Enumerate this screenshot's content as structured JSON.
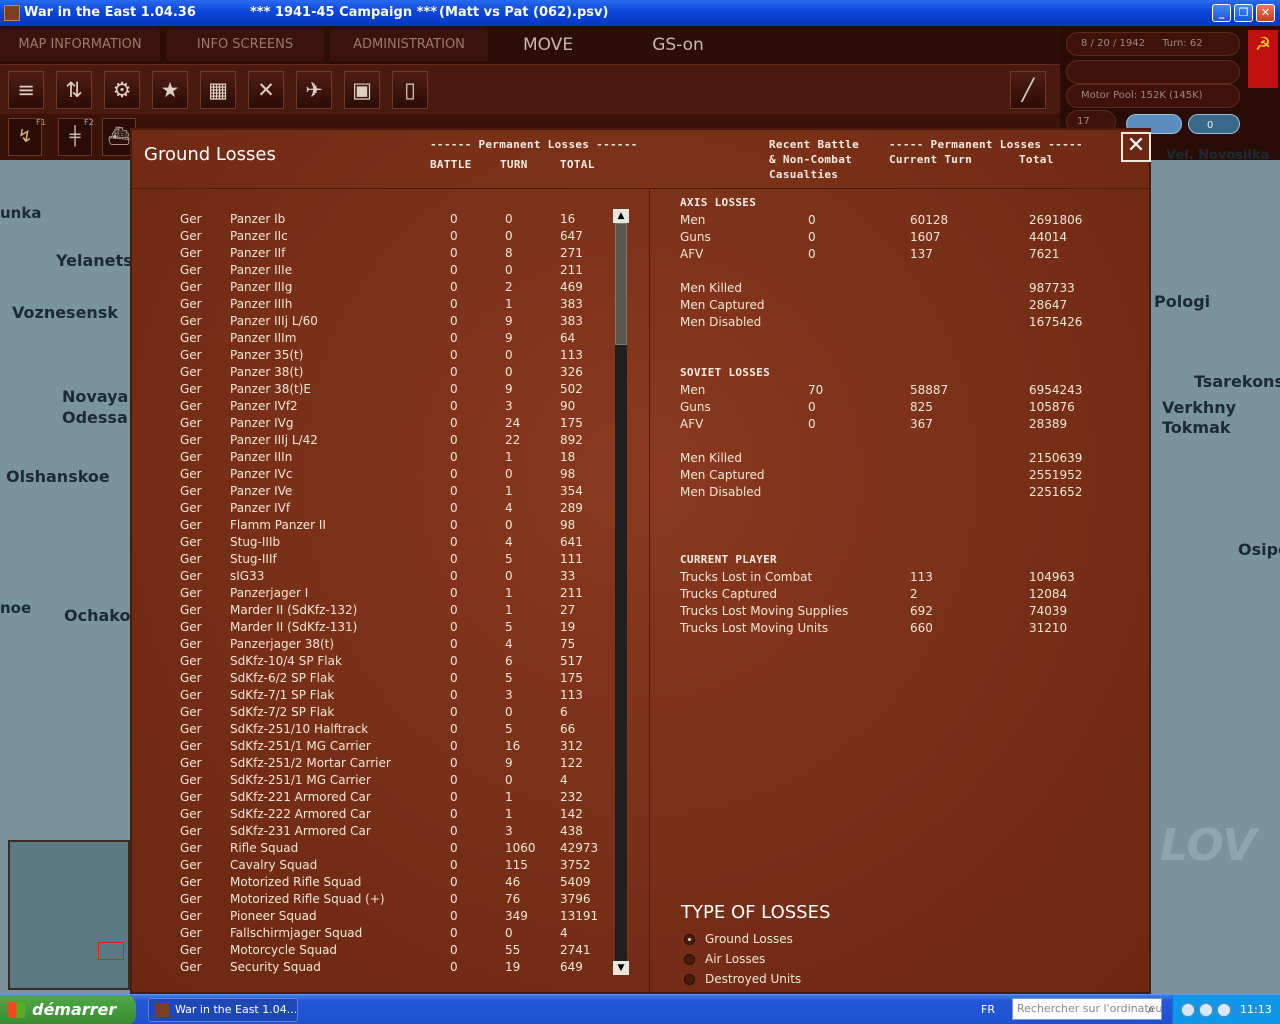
{
  "window": {
    "title_app": "War in the East 1.04.36",
    "title_campaign": "***   1941-45 Campaign   ***",
    "title_file": "(Matt vs Pat (062).psv)"
  },
  "menu": {
    "map_info": "MAP INFORMATION",
    "info_screens": "INFO SCREENS",
    "administration": "ADMINISTRATION",
    "move": "MOVE",
    "gs": "GS-on"
  },
  "status": {
    "date": "8 / 20 / 1942",
    "turn": "Turn: 62",
    "motor_pool": "Motor Pool:  152K (145K)",
    "num": "17",
    "zero": "0"
  },
  "toolbar": {
    "f1": "F1",
    "f2": "F2"
  },
  "map_labels": [
    "unka",
    "Yelanets",
    "Voznesensk",
    "Novaya",
    "Odessa",
    "Olshanskoe",
    "noe",
    "Ochakov",
    "Pologi",
    "Tsarekonst",
    "Verkhny",
    "Tokmak",
    "Osipe",
    "Vel. Novosilka",
    "LOV"
  ],
  "dialog": {
    "title": "Ground Losses",
    "perm_header": "------ Permanent Losses ------",
    "col_battle": "BATTLE",
    "col_turn": "TURN",
    "col_total": "TOTAL",
    "recent_l1": "Recent Battle",
    "recent_l2": "& Non-Combat",
    "recent_l3": "Casualties",
    "perm2_header": "----- Permanent Losses -----",
    "perm2_current": "Current Turn",
    "perm2_total": "Total",
    "close": "✕"
  },
  "rows": [
    [
      "Ger",
      "Panzer Ib",
      "0",
      "0",
      "16"
    ],
    [
      "Ger",
      "Panzer IIc",
      "0",
      "0",
      "647"
    ],
    [
      "Ger",
      "Panzer IIf",
      "0",
      "8",
      "271"
    ],
    [
      "Ger",
      "Panzer IIIe",
      "0",
      "0",
      "211"
    ],
    [
      "Ger",
      "Panzer IIIg",
      "0",
      "2",
      "469"
    ],
    [
      "Ger",
      "Panzer IIIh",
      "0",
      "1",
      "383"
    ],
    [
      "Ger",
      "Panzer IIIj L/60",
      "0",
      "9",
      "383"
    ],
    [
      "Ger",
      "Panzer IIIm",
      "0",
      "9",
      "64"
    ],
    [
      "Ger",
      "Panzer 35(t)",
      "0",
      "0",
      "113"
    ],
    [
      "Ger",
      "Panzer 38(t)",
      "0",
      "0",
      "326"
    ],
    [
      "Ger",
      "Panzer 38(t)E",
      "0",
      "9",
      "502"
    ],
    [
      "Ger",
      "Panzer IVf2",
      "0",
      "3",
      "90"
    ],
    [
      "Ger",
      "Panzer IVg",
      "0",
      "24",
      "175"
    ],
    [
      "Ger",
      "Panzer IIIj L/42",
      "0",
      "22",
      "892"
    ],
    [
      "Ger",
      "Panzer IIIn",
      "0",
      "1",
      "18"
    ],
    [
      "Ger",
      "Panzer IVc",
      "0",
      "0",
      "98"
    ],
    [
      "Ger",
      "Panzer IVe",
      "0",
      "1",
      "354"
    ],
    [
      "Ger",
      "Panzer IVf",
      "0",
      "4",
      "289"
    ],
    [
      "Ger",
      "Flamm Panzer II",
      "0",
      "0",
      "98"
    ],
    [
      "Ger",
      "Stug-IIIb",
      "0",
      "4",
      "641"
    ],
    [
      "Ger",
      "Stug-IIIf",
      "0",
      "5",
      "111"
    ],
    [
      "Ger",
      "sIG33",
      "0",
      "0",
      "33"
    ],
    [
      "Ger",
      "Panzerjager I",
      "0",
      "1",
      "211"
    ],
    [
      "Ger",
      "Marder II (SdKfz-132)",
      "0",
      "1",
      "27"
    ],
    [
      "Ger",
      "Marder II (SdKfz-131)",
      "0",
      "5",
      "19"
    ],
    [
      "Ger",
      "Panzerjager 38(t)",
      "0",
      "4",
      "75"
    ],
    [
      "Ger",
      "SdKfz-10/4 SP Flak",
      "0",
      "6",
      "517"
    ],
    [
      "Ger",
      "SdKfz-6/2 SP Flak",
      "0",
      "5",
      "175"
    ],
    [
      "Ger",
      "SdKfz-7/1 SP Flak",
      "0",
      "3",
      "113"
    ],
    [
      "Ger",
      "SdKfz-7/2 SP Flak",
      "0",
      "0",
      "6"
    ],
    [
      "Ger",
      "SdKfz-251/10 Halftrack",
      "0",
      "5",
      "66"
    ],
    [
      "Ger",
      "SdKfz-251/1 MG Carrier",
      "0",
      "16",
      "312"
    ],
    [
      "Ger",
      "SdKfz-251/2 Mortar Carrier",
      "0",
      "9",
      "122"
    ],
    [
      "Ger",
      "SdKfz-251/1 MG Carrier",
      "0",
      "0",
      "4"
    ],
    [
      "Ger",
      "SdKfz-221 Armored Car",
      "0",
      "1",
      "232"
    ],
    [
      "Ger",
      "SdKfz-222 Armored Car",
      "0",
      "1",
      "142"
    ],
    [
      "Ger",
      "SdKfz-231 Armored Car",
      "0",
      "3",
      "438"
    ],
    [
      "Ger",
      "Rifle Squad",
      "0",
      "1060",
      "42973"
    ],
    [
      "Ger",
      "Cavalry Squad",
      "0",
      "115",
      "3752"
    ],
    [
      "Ger",
      "Motorized Rifle Squad",
      "0",
      "46",
      "5409"
    ],
    [
      "Ger",
      "Motorized Rifle Squad (+)",
      "0",
      "76",
      "3796"
    ],
    [
      "Ger",
      "Pioneer Squad",
      "0",
      "349",
      "13191"
    ],
    [
      "Ger",
      "Fallschirmjager Squad",
      "0",
      "0",
      "4"
    ],
    [
      "Ger",
      "Motorcycle Squad",
      "0",
      "55",
      "2741"
    ],
    [
      "Ger",
      "Security Squad",
      "0",
      "19",
      "649"
    ]
  ],
  "axis": {
    "heading": "AXIS LOSSES",
    "rows": [
      [
        "Men",
        "0",
        "60128",
        "2691806"
      ],
      [
        "Guns",
        "0",
        "1607",
        "44014"
      ],
      [
        "AFV",
        "0",
        "137",
        "7621"
      ]
    ],
    "killed": [
      "Men Killed",
      "",
      "",
      "987733"
    ],
    "captured": [
      "Men Captured",
      "",
      "",
      "28647"
    ],
    "disabled": [
      "Men Disabled",
      "",
      "",
      "1675426"
    ]
  },
  "soviet": {
    "heading": "SOVIET LOSSES",
    "rows": [
      [
        "Men",
        "70",
        "58887",
        "6954243"
      ],
      [
        "Guns",
        "0",
        "825",
        "105876"
      ],
      [
        "AFV",
        "0",
        "367",
        "28389"
      ]
    ],
    "killed": [
      "Men Killed",
      "",
      "",
      "2150639"
    ],
    "captured": [
      "Men Captured",
      "",
      "",
      "2551952"
    ],
    "disabled": [
      "Men Disabled",
      "",
      "",
      "2251652"
    ]
  },
  "player": {
    "heading": "CURRENT PLAYER",
    "rows": [
      [
        "Trucks Lost in Combat",
        "",
        "113",
        "104963"
      ],
      [
        "Trucks Captured",
        "",
        "2",
        "12084"
      ],
      [
        "Trucks Lost Moving Supplies",
        "",
        "692",
        "74039"
      ],
      [
        "Trucks Lost Moving Units",
        "",
        "660",
        "31210"
      ]
    ]
  },
  "loss_types": {
    "heading": "TYPE OF LOSSES",
    "options": [
      "Ground Losses",
      "Air Losses",
      "Destroyed Units"
    ],
    "selected": 0
  },
  "taskbar": {
    "start": "démarrer",
    "task": "War in the East 1.04....",
    "lang": "FR",
    "search_placeholder": "Rechercher sur l'ordinateur",
    "clock": "11:13"
  },
  "colors": {
    "panel": "#7a3018",
    "titlebar": "#0a46d8",
    "taskbar": "#2458d8",
    "start": "#3a8a32"
  }
}
